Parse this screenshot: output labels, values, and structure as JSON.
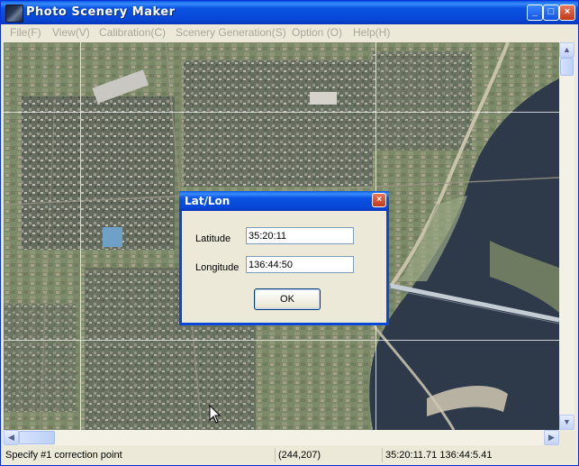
{
  "window": {
    "title": "Photo Scenery Maker",
    "controls": {
      "minimize": "_",
      "maximize": "□",
      "close": "×"
    }
  },
  "menu": {
    "items": [
      "File(F)",
      "View(V)",
      "Calibration(C)",
      "Scenery Generation(S)",
      "Option (O)",
      "Help(H)"
    ]
  },
  "statusbar": {
    "message": "Specify #1 correction point",
    "coordinates": "(244,207)",
    "latlon": "35:20:11.71 136:44:5.41"
  },
  "dialog": {
    "title": "Lat/Lon",
    "close": "×",
    "latitude_label": "Latitude",
    "latitude_value": "35:20:11",
    "longitude_label": "Longitude",
    "longitude_value": "136:44:50",
    "ok_label": "OK"
  },
  "colors": {
    "titlebar": "#0746d6",
    "close_button": "#c2391a",
    "window_face": "#ece9d8",
    "map_base": "#6e7a63",
    "river": "#2e3a4a"
  },
  "icons": {
    "scroll_up": "▲",
    "scroll_down": "▼",
    "scroll_left": "◀",
    "scroll_right": "▶"
  }
}
